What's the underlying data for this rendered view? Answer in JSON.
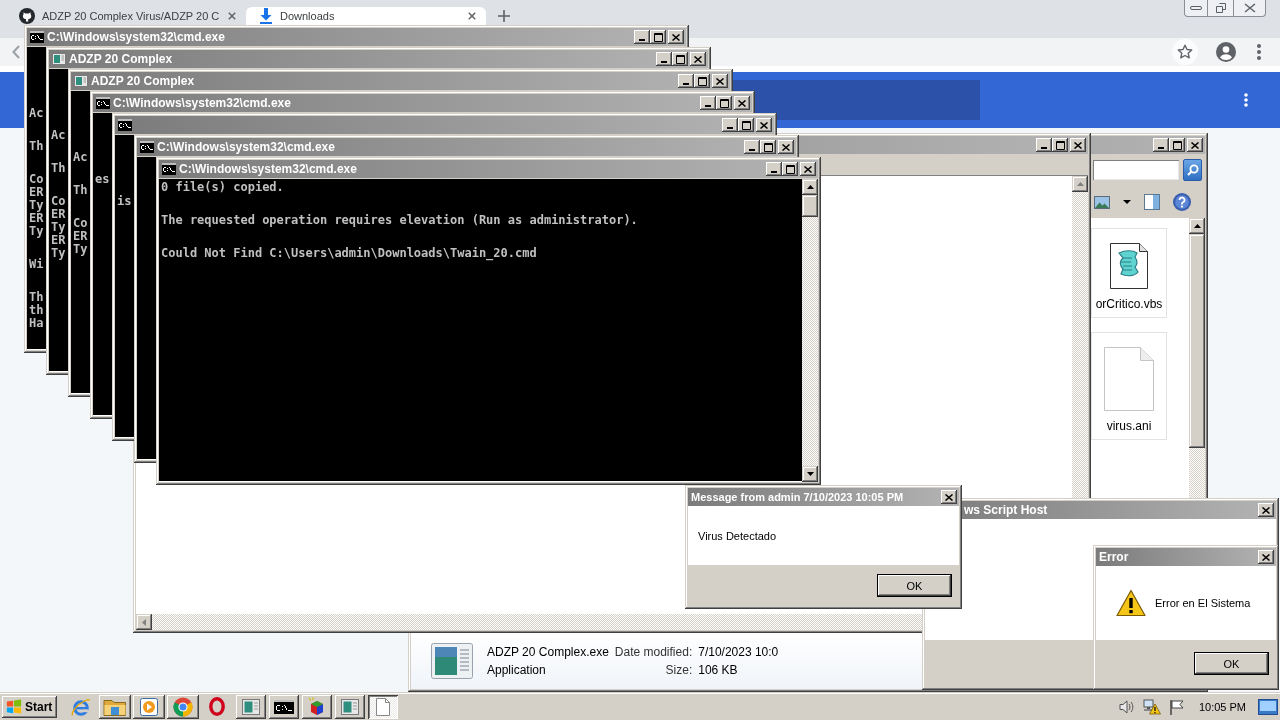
{
  "browser": {
    "tabs": [
      {
        "title": "ADZP 20 Complex Virus/ADZP 20 C",
        "kind": "repository",
        "selected": false
      },
      {
        "title": "Downloads",
        "kind": "downloads",
        "selected": true
      }
    ]
  },
  "explorer": {
    "files": [
      {
        "name": "orCritico.vbs",
        "kind": "script"
      },
      {
        "name": "virus.ani",
        "kind": "blank"
      }
    ],
    "details": {
      "name": "ADZP 20 Complex.exe",
      "type": "Application",
      "date_label": "Date modified:",
      "date": "7/10/2023 10:0",
      "size_label": "Size:",
      "size": "106 KB"
    }
  },
  "consoles": [
    {
      "kind": "console",
      "title": "C:\\Windows\\system32\\cmd.exe",
      "blocks": [
        [
          "Ac"
        ],
        [
          "Th"
        ],
        [
          "Co",
          "ER",
          "Ty",
          "ER",
          "Ty"
        ],
        [
          "Wi"
        ],
        [
          "Th",
          "th",
          "Ha"
        ]
      ]
    },
    {
      "kind": "app",
      "title": "ADZP 20 Complex",
      "blocks": [
        [
          "Ac"
        ],
        [
          "Th"
        ],
        [
          "Co",
          "ER",
          "Ty",
          "ER",
          "Ty"
        ]
      ]
    },
    {
      "kind": "app",
      "title": "ADZP 20 Complex",
      "blocks": [
        [
          "Ac"
        ],
        [
          "Th"
        ],
        [
          "Co",
          "ER",
          "Ty"
        ]
      ]
    },
    {
      "kind": "console",
      "title": "C:\\Windows\\system32\\cmd.exe",
      "blocks": [
        [
          "es"
        ]
      ]
    },
    {
      "kind": "console",
      "blocks": [
        [
          "is"
        ]
      ]
    },
    {
      "kind": "console",
      "title": "C:\\Windows\\system32\\cmd.exe"
    },
    {
      "kind": "console",
      "title": "C:\\Windows\\system32\\cmd.exe",
      "blocks": [
        [
          "0 file(s) copied."
        ],
        [
          "The requested operation requires elevation (Run as administrator)."
        ],
        [
          "Could Not Find C:\\Users\\admin\\Downloads\\Twain_20.cmd"
        ]
      ]
    }
  ],
  "script_host_dialog": {
    "title": "ws Script Host"
  },
  "error_dialog": {
    "title": "Error",
    "text": "Error en El Sistema",
    "button": "OK"
  },
  "message_dialog": {
    "title": "Message from admin 7/10/2023 10:05 PM",
    "text": "Virus Detectado",
    "button": "OK"
  },
  "taskbar": {
    "start": "Start",
    "launchers": [
      {
        "kind": "ie",
        "active": false
      },
      {
        "kind": "folder",
        "active": true
      },
      {
        "kind": "media",
        "active": true
      },
      {
        "kind": "chrome",
        "active": true
      },
      {
        "kind": "opera",
        "active": false
      }
    ],
    "tasks": [
      {
        "kind": "app",
        "selected": false
      },
      {
        "kind": "console",
        "selected": false
      },
      {
        "kind": "cube",
        "selected": false
      },
      {
        "kind": "app",
        "selected": false
      },
      {
        "kind": "document",
        "selected": true
      }
    ],
    "clock": "10:05 PM"
  }
}
